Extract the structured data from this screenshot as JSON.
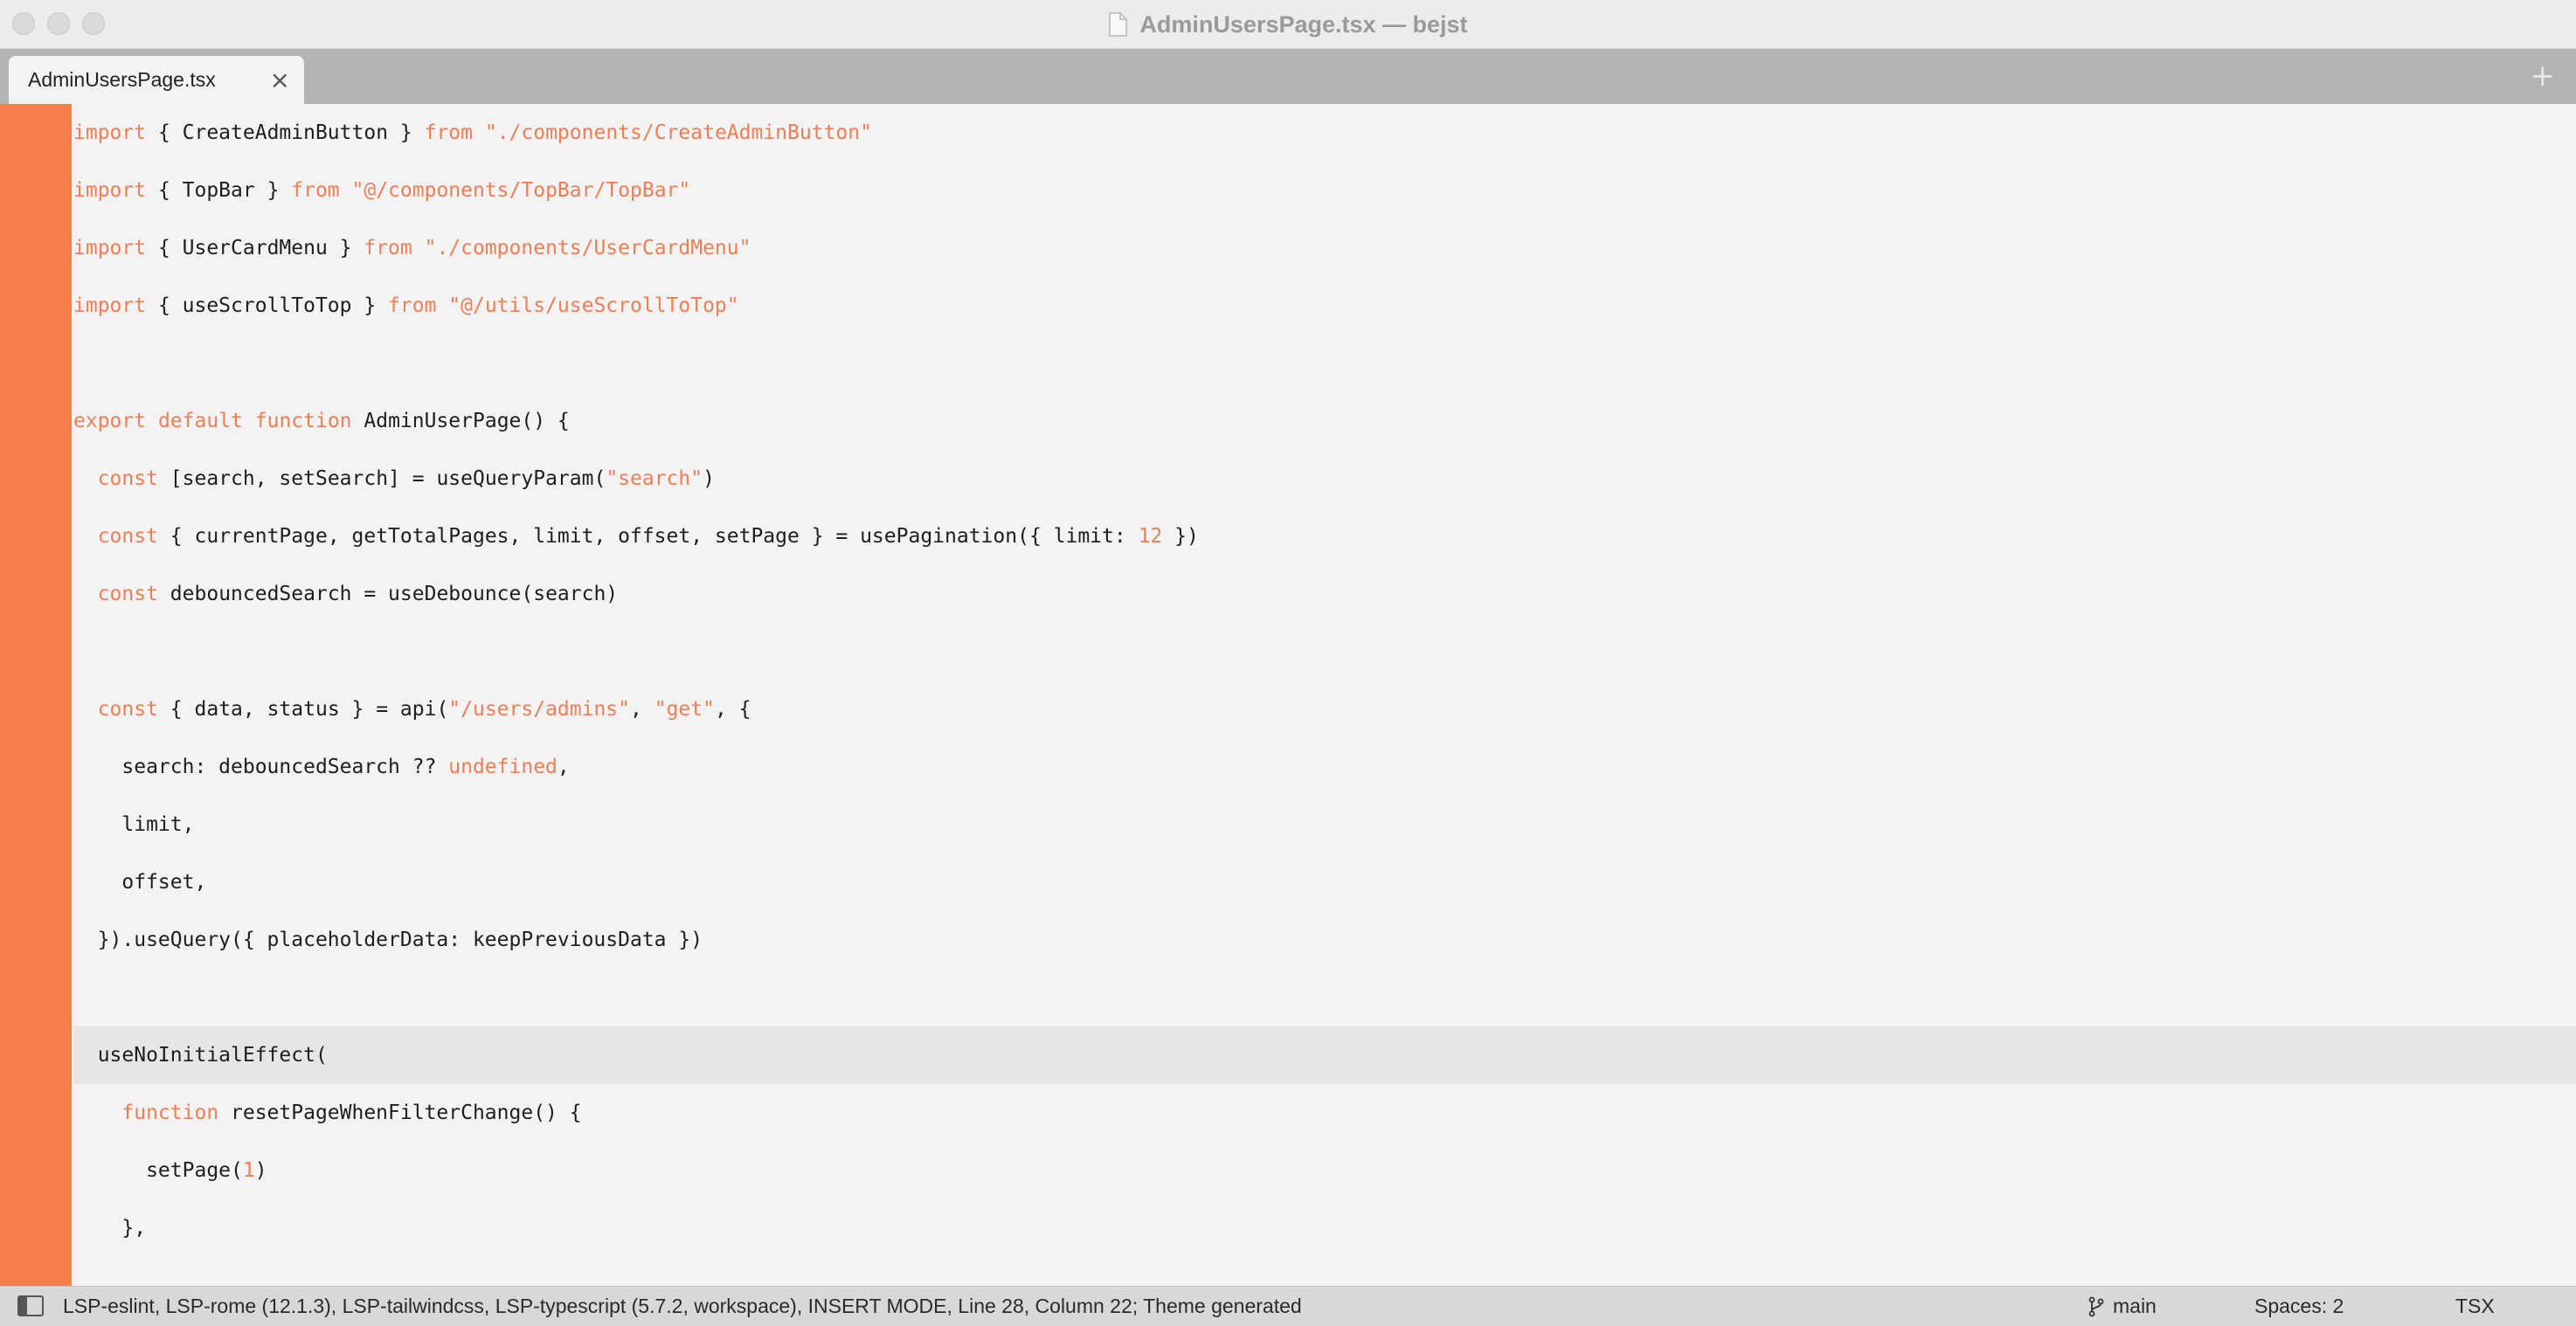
{
  "window": {
    "title": "AdminUsersPage.tsx — bejst"
  },
  "tabs": [
    {
      "label": "AdminUsersPage.tsx",
      "close_glyph": "×"
    }
  ],
  "tabbar": {
    "add_glyph": "+"
  },
  "editor": {
    "current_line_index": 16,
    "lines": [
      [
        {
          "t": "import",
          "c": "kw"
        },
        {
          "t": " { CreateAdminButton } "
        },
        {
          "t": "from",
          "c": "kw"
        },
        {
          "t": " "
        },
        {
          "t": "\"./components/CreateAdminButton\"",
          "c": "str"
        }
      ],
      [
        {
          "t": "import",
          "c": "kw"
        },
        {
          "t": " { TopBar } "
        },
        {
          "t": "from",
          "c": "kw"
        },
        {
          "t": " "
        },
        {
          "t": "\"@/components/TopBar/TopBar\"",
          "c": "str"
        }
      ],
      [
        {
          "t": "import",
          "c": "kw"
        },
        {
          "t": " { UserCardMenu } "
        },
        {
          "t": "from",
          "c": "kw"
        },
        {
          "t": " "
        },
        {
          "t": "\"./components/UserCardMenu\"",
          "c": "str"
        }
      ],
      [
        {
          "t": "import",
          "c": "kw"
        },
        {
          "t": " { useScrollToTop } "
        },
        {
          "t": "from",
          "c": "kw"
        },
        {
          "t": " "
        },
        {
          "t": "\"@/utils/useScrollToTop\"",
          "c": "str"
        }
      ],
      [],
      [
        {
          "t": "export",
          "c": "kw"
        },
        {
          "t": " "
        },
        {
          "t": "default",
          "c": "kw"
        },
        {
          "t": " "
        },
        {
          "t": "function",
          "c": "kw"
        },
        {
          "t": " AdminUserPage() {"
        }
      ],
      [
        {
          "t": "  "
        },
        {
          "t": "const",
          "c": "kw"
        },
        {
          "t": " [search, setSearch] = useQueryParam("
        },
        {
          "t": "\"search\"",
          "c": "str"
        },
        {
          "t": ")"
        }
      ],
      [
        {
          "t": "  "
        },
        {
          "t": "const",
          "c": "kw"
        },
        {
          "t": " { currentPage, getTotalPages, limit, offset, setPage } = usePagination({ limit: "
        },
        {
          "t": "12",
          "c": "num"
        },
        {
          "t": " })"
        }
      ],
      [
        {
          "t": "  "
        },
        {
          "t": "const",
          "c": "kw"
        },
        {
          "t": " debouncedSearch = useDebounce(search)"
        }
      ],
      [],
      [
        {
          "t": "  "
        },
        {
          "t": "const",
          "c": "kw"
        },
        {
          "t": " { data, status } = api("
        },
        {
          "t": "\"/users/admins\"",
          "c": "str"
        },
        {
          "t": ", "
        },
        {
          "t": "\"get\"",
          "c": "str"
        },
        {
          "t": ", {"
        }
      ],
      [
        {
          "t": "    search: debouncedSearch ?? "
        },
        {
          "t": "undefined",
          "c": "kw"
        },
        {
          "t": ","
        }
      ],
      [
        {
          "t": "    limit,"
        }
      ],
      [
        {
          "t": "    offset,"
        }
      ],
      [
        {
          "t": "  }).useQuery({ placeholderData: keepPreviousData })"
        }
      ],
      [],
      [
        {
          "t": "  useNoInitialEffect("
        }
      ],
      [
        {
          "t": "    "
        },
        {
          "t": "function",
          "c": "kw"
        },
        {
          "t": " resetPageWhenFilterChange() {"
        }
      ],
      [
        {
          "t": "      setPage("
        },
        {
          "t": "1",
          "c": "num"
        },
        {
          "t": ")"
        }
      ],
      [
        {
          "t": "    },"
        }
      ]
    ]
  },
  "statusbar": {
    "text": "LSP-eslint, LSP-rome (12.1.3), LSP-tailwindcss, LSP-typescript (5.7.2, workspace), INSERT MODE, Line 28, Column 22; Theme generated",
    "branch": "main",
    "indentation": "Spaces: 2",
    "syntax": "TSX"
  },
  "colors": {
    "gutter": "#f57d4c",
    "keyword": "#ef7d55",
    "background": "#f3f3f3",
    "tabbar": "#b3b3b3"
  },
  "icons": {
    "file": "document-icon",
    "sidebar": "sidebar-toggle-icon",
    "branch": "git-branch-icon"
  }
}
